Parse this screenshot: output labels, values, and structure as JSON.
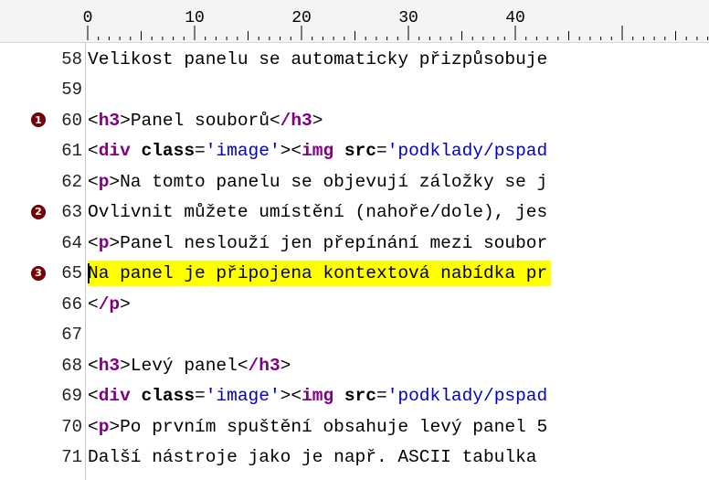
{
  "ruler": {
    "labels": [
      "0",
      "10",
      "20",
      "30",
      "40"
    ]
  },
  "lines": [
    {
      "num": "58",
      "marker": "",
      "highlight": false,
      "segments": [
        {
          "t": "text",
          "v": "Velikost panelu se automaticky přizpůsobuje"
        }
      ]
    },
    {
      "num": "59",
      "marker": "",
      "highlight": false,
      "segments": []
    },
    {
      "num": "60",
      "marker": "1",
      "highlight": false,
      "segments": [
        {
          "t": "punc",
          "v": "<"
        },
        {
          "t": "tag",
          "v": "h3"
        },
        {
          "t": "punc",
          "v": ">"
        },
        {
          "t": "text",
          "v": "Panel souborů"
        },
        {
          "t": "punc",
          "v": "<"
        },
        {
          "t": "tag",
          "v": "/h3"
        },
        {
          "t": "punc",
          "v": ">"
        }
      ]
    },
    {
      "num": "61",
      "marker": "",
      "highlight": false,
      "segments": [
        {
          "t": "punc",
          "v": "<"
        },
        {
          "t": "tag",
          "v": "div"
        },
        {
          "t": "text",
          "v": " "
        },
        {
          "t": "attr",
          "v": "class"
        },
        {
          "t": "punc",
          "v": "="
        },
        {
          "t": "val",
          "v": "'image'"
        },
        {
          "t": "punc",
          "v": "><"
        },
        {
          "t": "tag",
          "v": "img"
        },
        {
          "t": "text",
          "v": " "
        },
        {
          "t": "attr",
          "v": "src"
        },
        {
          "t": "punc",
          "v": "="
        },
        {
          "t": "val",
          "v": "'podklady/pspad"
        }
      ]
    },
    {
      "num": "62",
      "marker": "",
      "highlight": false,
      "segments": [
        {
          "t": "punc",
          "v": "<"
        },
        {
          "t": "tag",
          "v": "p"
        },
        {
          "t": "punc",
          "v": ">"
        },
        {
          "t": "text",
          "v": "Na tomto panelu se objevují záložky se j"
        }
      ]
    },
    {
      "num": "63",
      "marker": "2",
      "highlight": false,
      "segments": [
        {
          "t": "text",
          "v": "Ovlivnit můžete umístění (nahoře/dole), jes"
        }
      ]
    },
    {
      "num": "64",
      "marker": "",
      "highlight": false,
      "segments": [
        {
          "t": "punc",
          "v": "<"
        },
        {
          "t": "tag",
          "v": "p"
        },
        {
          "t": "punc",
          "v": ">"
        },
        {
          "t": "text",
          "v": "Panel neslouží jen přepínání mezi soubor"
        }
      ]
    },
    {
      "num": "65",
      "marker": "3",
      "highlight": true,
      "segments": [
        {
          "t": "cursor",
          "v": ""
        },
        {
          "t": "text",
          "v": "Na panel je připojena kontextová nabídka pr"
        }
      ]
    },
    {
      "num": "66",
      "marker": "",
      "highlight": false,
      "segments": [
        {
          "t": "punc",
          "v": "<"
        },
        {
          "t": "tag",
          "v": "/p"
        },
        {
          "t": "punc",
          "v": ">"
        }
      ]
    },
    {
      "num": "67",
      "marker": "",
      "highlight": false,
      "segments": []
    },
    {
      "num": "68",
      "marker": "",
      "highlight": false,
      "segments": [
        {
          "t": "punc",
          "v": "<"
        },
        {
          "t": "tag",
          "v": "h3"
        },
        {
          "t": "punc",
          "v": ">"
        },
        {
          "t": "text",
          "v": "Levý panel"
        },
        {
          "t": "punc",
          "v": "<"
        },
        {
          "t": "tag",
          "v": "/h3"
        },
        {
          "t": "punc",
          "v": ">"
        }
      ]
    },
    {
      "num": "69",
      "marker": "",
      "highlight": false,
      "segments": [
        {
          "t": "punc",
          "v": "<"
        },
        {
          "t": "tag",
          "v": "div"
        },
        {
          "t": "text",
          "v": " "
        },
        {
          "t": "attr",
          "v": "class"
        },
        {
          "t": "punc",
          "v": "="
        },
        {
          "t": "val",
          "v": "'image'"
        },
        {
          "t": "punc",
          "v": "><"
        },
        {
          "t": "tag",
          "v": "img"
        },
        {
          "t": "text",
          "v": " "
        },
        {
          "t": "attr",
          "v": "src"
        },
        {
          "t": "punc",
          "v": "="
        },
        {
          "t": "val",
          "v": "'podklady/pspad"
        }
      ]
    },
    {
      "num": "70",
      "marker": "",
      "highlight": false,
      "segments": [
        {
          "t": "punc",
          "v": "<"
        },
        {
          "t": "tag",
          "v": "p"
        },
        {
          "t": "punc",
          "v": ">"
        },
        {
          "t": "text",
          "v": "Po prvním spuštění obsahuje levý panel 5"
        }
      ]
    },
    {
      "num": "71",
      "marker": "",
      "highlight": false,
      "segments": [
        {
          "t": "text",
          "v": "Další nástroje jako je např. ASCII tabulka"
        }
      ]
    }
  ],
  "colors": {
    "tag": "#800080",
    "value": "#0000c0",
    "highlight": "#ffff00",
    "marker": "#7a0008"
  }
}
